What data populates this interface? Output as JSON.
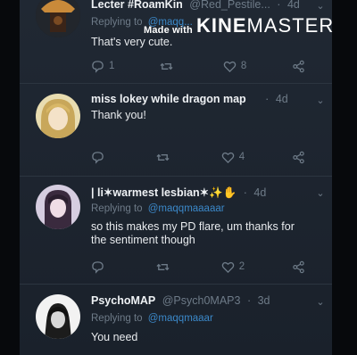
{
  "watermark": {
    "made_with": "Made with",
    "brand_bold": "KINE",
    "brand_light": "MASTER"
  },
  "tweets": [
    {
      "name": "Lecter #RoamKin",
      "handle": "@Red_Pestile...",
      "time": "4d",
      "reply_prefix": "Replying to",
      "reply_mention": "@maqq...",
      "text": "That's very cute.",
      "actions": {
        "reply": "1",
        "retweet": "",
        "like": "8"
      },
      "avatar_color": "#8c5a2a"
    },
    {
      "name": "miss lokey while dragon map",
      "handle": "",
      "time": "4d",
      "reply_prefix": "",
      "reply_mention": "",
      "text": "Thank you!",
      "actions": {
        "reply": "",
        "retweet": "",
        "like": "4"
      },
      "avatar_color": "#d9c88e"
    },
    {
      "name": "| li✶warmest lesbian✶✨✋",
      "handle": "",
      "time": "4d",
      "reply_prefix": "Replying to",
      "reply_mention": "@maqqmaaaaar",
      "text_a": "so this makes my PD flare, um thanks for",
      "text_b": "the sentiment though",
      "actions": {
        "reply": "",
        "retweet": "",
        "like": "2"
      },
      "avatar_color": "#b9a6c8"
    },
    {
      "name": "PsychoMAP",
      "handle": "@Psych0MAP3",
      "time": "3d",
      "reply_prefix": "Replying to",
      "reply_mention": "@maqqmaaar",
      "text": "You need",
      "actions": {
        "reply": "",
        "retweet": "",
        "like": ""
      },
      "avatar_color": "#e0e0e0"
    }
  ]
}
